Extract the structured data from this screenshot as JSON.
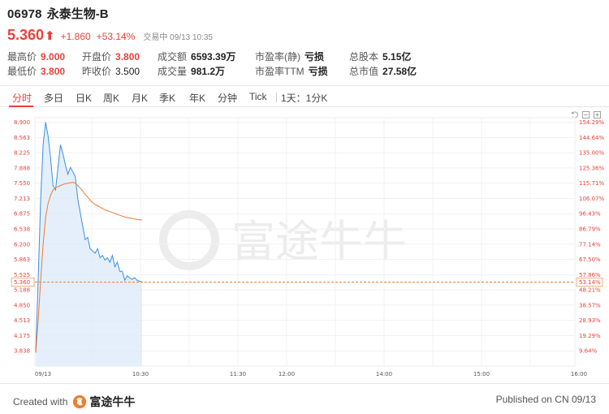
{
  "stock": {
    "code": "06978",
    "name": "永泰生物-B",
    "price": "5.360",
    "change": "+1.860",
    "change_pct": "+53.14%",
    "status": "交易中 09/13 10:35"
  },
  "stats": {
    "high_label": "最高价",
    "high": "9.000",
    "low_label": "最低价",
    "low": "3.800",
    "open_label": "开盘价",
    "open": "3.800",
    "prev_close_label": "昨收价",
    "prev_close": "3.500",
    "turnover_label": "成交额",
    "turnover": "6593.39万",
    "volume_label": "成交量",
    "volume": "981.2万",
    "pe_static_label": "市盈率(静)",
    "pe_static": "亏损",
    "pe_ttm_label": "市盈率TTM",
    "pe_ttm": "亏损",
    "total_shares_label": "总股本",
    "total_shares": "5.15亿",
    "market_cap_label": "总市值",
    "market_cap": "27.58亿"
  },
  "tabs": [
    "分时",
    "多日",
    "日K",
    "周K",
    "月K",
    "季K",
    "年K",
    "分钟",
    "Tick"
  ],
  "interval_label": "1天：1分K",
  "active_tab": "分时",
  "watermark": "富途牛牛",
  "chart_data": {
    "type": "line",
    "y_left_ticks": [
      "8.900",
      "8.563",
      "8.225",
      "7.888",
      "7.550",
      "7.213",
      "6.875",
      "6.538",
      "6.200",
      "5.863",
      "5.525",
      "5.188",
      "4.850",
      "4.513",
      "4.175",
      "3.838"
    ],
    "y_right_ticks": [
      "154.29%",
      "144.64%",
      "135.00%",
      "125.36%",
      "115.71%",
      "106.07%",
      "96.43%",
      "86.79%",
      "77.14%",
      "67.50%",
      "57.86%",
      "48.21%",
      "38.57%",
      "28.93%",
      "19.29%",
      "9.64%"
    ],
    "current_price_label": "5.360",
    "current_pct_label": "53.14%",
    "x_labels": [
      "09/13",
      "10:30",
      "11:30",
      "12:00",
      "14:00",
      "15:00",
      "16:00"
    ],
    "ylim": [
      3.5,
      9.0
    ],
    "series": [
      {
        "color": "#3a8ee6",
        "values": [
          3.8,
          5.4,
          7.2,
          8.4,
          8.9,
          8.6,
          8.1,
          7.5,
          7.4,
          7.9,
          8.4,
          8.2,
          7.95,
          7.75,
          7.9,
          7.8,
          7.7,
          7.2,
          6.9,
          6.6,
          6.3,
          6.35,
          6.1,
          6.05,
          6.0,
          6.1,
          5.9,
          5.95,
          5.85,
          5.9,
          5.8,
          5.95,
          5.7,
          5.8,
          5.6,
          5.6,
          5.4,
          5.5,
          5.45,
          5.42,
          5.46,
          5.4,
          5.38,
          5.36
        ]
      },
      {
        "color": "#f07b2f",
        "values": [
          3.8,
          4.5,
          5.4,
          6.2,
          6.8,
          7.1,
          7.28,
          7.4,
          7.45,
          7.47,
          7.5,
          7.52,
          7.54,
          7.55,
          7.56,
          7.57,
          7.55,
          7.5,
          7.44,
          7.38,
          7.3,
          7.24,
          7.18,
          7.12,
          7.08,
          7.05,
          7.02,
          6.99,
          6.96,
          6.94,
          6.92,
          6.9,
          6.88,
          6.86,
          6.84,
          6.82,
          6.8,
          6.79,
          6.78,
          6.77,
          6.76,
          6.75,
          6.74,
          6.74
        ]
      }
    ]
  },
  "footer": {
    "created_with": "Created with",
    "brand": "富途牛牛",
    "published": "Published on CN 09/13"
  }
}
